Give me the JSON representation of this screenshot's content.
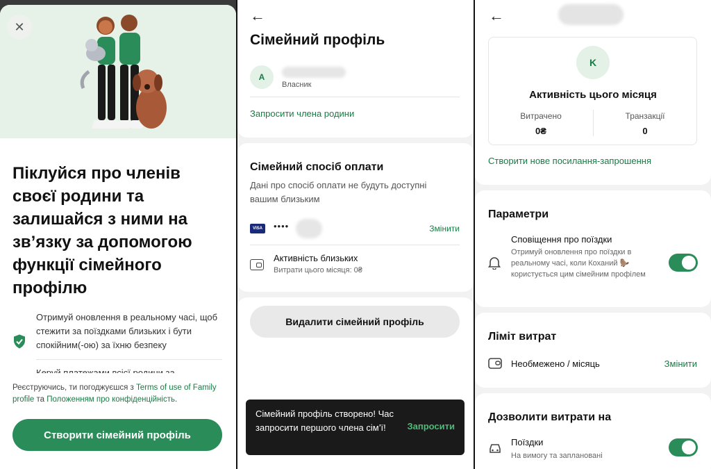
{
  "screen1": {
    "headline": "Піклуйся про членів своєї родини та залишайся з ними на зв’язку за допомогою функції сімейного профілю",
    "feature1": "Отримуй оновлення в реальному часі, щоб стежити за поїздками близьких і бути спокійним(-ою) за їхню безпеку",
    "feature2": "Керуй платежами всієї родини за",
    "terms_prefix": "Реєструючись, ти погоджуєшся з ",
    "terms_link": "Terms of use of Family profile",
    "terms_mid": " та ",
    "privacy_link": "Положенням про конфіденційність",
    "terms_suffix": ".",
    "cta": "Створити сімейний профіль"
  },
  "screen2": {
    "title": "Сімейний профіль",
    "owner_initial": "A",
    "owner_role": "Власник",
    "invite_link": "Запросити члена родини",
    "payment_title": "Сімейний спосіб оплати",
    "payment_desc": "Дані про спосіб оплати не будуть доступні вашим близьким",
    "card_brand": "VISA",
    "card_dots": "••••",
    "change": "Змінити",
    "activity_title": "Активність близьких",
    "activity_sub": "Витрати цього місяця: 0₴",
    "delete_button": "Видалити сімейний профіль",
    "toast_text": "Сімейний профіль створено! Час запросити першого члена сім’ї!",
    "toast_action": "Запросити"
  },
  "screen3": {
    "avatar_initial": "K",
    "activity_title": "Активність цього місяця",
    "spent_label": "Витрачено",
    "spent_value": "0₴",
    "tx_label": "Транзакції",
    "tx_value": "0",
    "invite_link": "Створити нове посилання-запрошення",
    "params_title": "Параметри",
    "notif_title": "Сповіщення про поїздки",
    "notif_desc": "Отримуй оновлення про поїздки в реальному часі, коли Коханий 🦫 користується цим сімейним профілем",
    "notif_on": true,
    "limit_title": "Ліміт витрат",
    "limit_value": "Необмежено / місяць",
    "limit_change": "Змінити",
    "allow_title": "Дозволити витрати на",
    "rides_title": "Поїздки",
    "rides_sub": "На вимогу та заплановані",
    "rides_on": true
  },
  "colors": {
    "accent": "#2a8c59",
    "link": "#1a7a45",
    "hero_bg": "#e6f2e8",
    "toast_bg": "#1a1a1a"
  }
}
